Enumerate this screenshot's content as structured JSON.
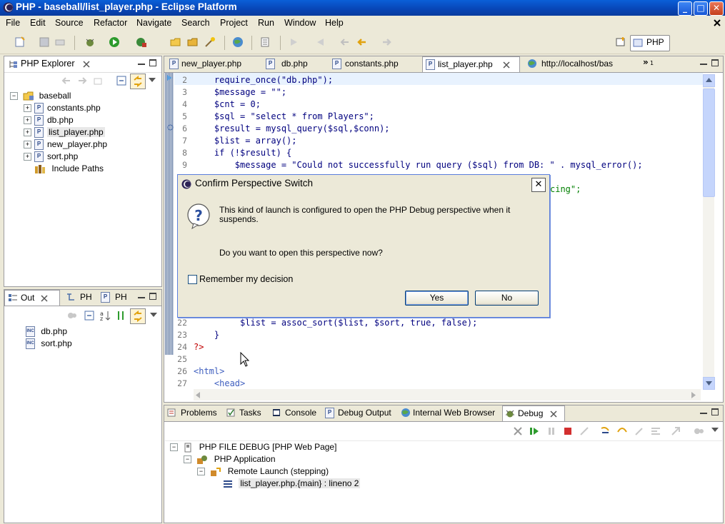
{
  "window": {
    "title": "PHP - baseball/list_player.php - Eclipse Platform",
    "min": "_",
    "max": "□",
    "close": "✕"
  },
  "menu": [
    "File",
    "Edit",
    "Source",
    "Refactor",
    "Navigate",
    "Search",
    "Project",
    "Run",
    "Window",
    "Help"
  ],
  "perspective": {
    "label": "PHP",
    "close": "✕"
  },
  "explorer": {
    "title": "PHP Explorer",
    "root": "baseball",
    "files": [
      "constants.php",
      "db.php",
      "list_player.php",
      "new_player.php",
      "sort.php"
    ],
    "include": "Include Paths",
    "selected_index": 2
  },
  "outline": {
    "tabs": [
      "Out",
      "PH",
      "PH"
    ],
    "files": [
      "db.php",
      "sort.php"
    ]
  },
  "editor": {
    "tabs": [
      "new_player.php",
      "db.php",
      "constants.php",
      "list_player.php",
      "http://localhost/bas"
    ],
    "overflow": "»",
    "overflow_count": "1",
    "active_tab": 3,
    "lines": [
      {
        "n": "2",
        "text": "    require_once(\"db.php\");"
      },
      {
        "n": "3",
        "text": "    $message = \"\";"
      },
      {
        "n": "4",
        "text": "    $cnt = 0;"
      },
      {
        "n": "5",
        "text": "    $sql = \"select * from Players\";"
      },
      {
        "n": "6",
        "text": "    $result = mysql_query($sql,$conn);"
      },
      {
        "n": "7",
        "text": "    $list = array();"
      },
      {
        "n": "8",
        "text": "    if (!$result) {"
      },
      {
        "n": "9",
        "text": "        $message = \"Could not successfully run query ($sql) from DB: \" . mysql_error();"
      }
    ],
    "partial_line": "cing\";",
    "lines_bottom": [
      {
        "n": "22",
        "text": "         $list = assoc_sort($list, $sort, true, false);"
      },
      {
        "n": "23",
        "text": "    }"
      },
      {
        "n": "24",
        "text": "?>"
      },
      {
        "n": "25",
        "text": ""
      },
      {
        "n": "26",
        "text": "<html>"
      },
      {
        "n": "27",
        "text": "    <head>"
      }
    ]
  },
  "bottom": {
    "tabs": [
      "Problems",
      "Tasks",
      "Console",
      "Debug Output",
      "Internal Web Browser",
      "Debug"
    ],
    "active_tab": 5,
    "tree": [
      {
        "level": 0,
        "text": "PHP FILE DEBUG [PHP Web Page]"
      },
      {
        "level": 1,
        "text": "PHP Application"
      },
      {
        "level": 2,
        "text": "Remote Launch (stepping)"
      },
      {
        "level": 3,
        "text": "list_player.php.{main} : lineno 2"
      }
    ]
  },
  "dialog": {
    "title": "Confirm Perspective Switch",
    "message1": "This kind of launch is configured to open the PHP Debug perspective when it",
    "message1b": "suspends.",
    "message2": "Do you want to open this perspective now?",
    "checkbox_label": "Remember my decision",
    "checkbox_checked": false,
    "yes": "Yes",
    "no": "No",
    "close": "✕"
  }
}
